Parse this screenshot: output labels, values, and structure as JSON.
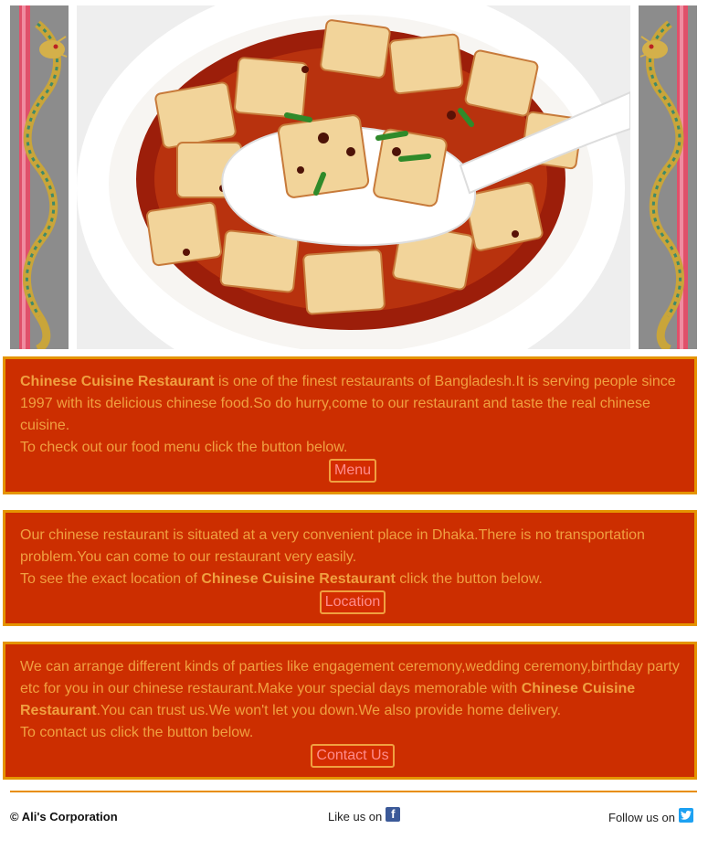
{
  "banner": {
    "dish_image": "mapo-tofu-photo",
    "left_decor": "dragon-pillar",
    "right_decor": "dragon-pillar"
  },
  "about": {
    "restaurant_name": "Chinese Cuisine Restaurant",
    "text_1": " is one of the finest restaurants of Bangladesh.It is serving people since 1997 with its delicious chinese food.So do hurry,come to our restaurant and taste the real chinese cuisine.",
    "text_2": "To check out our food menu click the button below.",
    "button_label": "Menu"
  },
  "location": {
    "text_1": "Our chinese restaurant is situated at a very convenient place in Dhaka.There is no transportation problem.You can come to our restaurant very easily.",
    "text_2": "To see the exact location of ",
    "restaurant_name": "Chinese Cuisine Restaurant",
    "text_3": " click the button below.",
    "button_label": "Location"
  },
  "contact": {
    "text_1": "We can arrange different kinds of parties like engagement ceremony,wedding ceremony,birthday party etc for you in our chinese restaurant.Make your special days memorable with ",
    "restaurant_name": "Chinese Cuisine Restaurant",
    "text_2": ".You can trust us.We won't let you down.We also provide home delivery.",
    "text_3": "To contact us click the button below.",
    "button_label": "Contact Us"
  },
  "footer": {
    "copyright": "© Ali's Corporation",
    "like_label": "Like us on",
    "like_icon": "facebook-icon",
    "follow_label": "Follow us on",
    "follow_icon": "twitter-icon"
  },
  "colors": {
    "box_background": "#cc2e00",
    "box_border": "#e59400",
    "box_text": "#f0a040",
    "button_text": "#ff8c8c",
    "footer_rule": "#e88d00"
  }
}
